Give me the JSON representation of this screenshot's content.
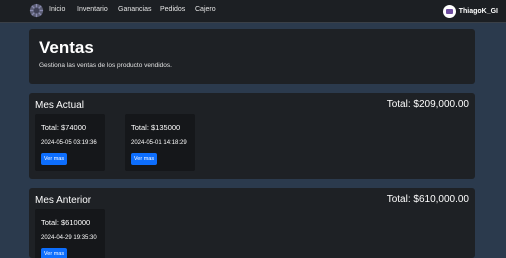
{
  "nav": {
    "items": [
      "Inicio",
      "Inventario",
      "Ganancias",
      "Pedidos",
      "Cajero"
    ],
    "username": "ThiagoK_GI"
  },
  "header": {
    "title": "Ventas",
    "subtitle": "Gestiona las ventas de los producto vendidos."
  },
  "sections": [
    {
      "title": "Mes Actual",
      "total": "Total: $209,000.00",
      "cards": [
        {
          "total": "Total: $74000",
          "date": "2024-05-05 03:19:36",
          "button": "Ver mas"
        },
        {
          "total": "Total: $135000",
          "date": "2024-05-01 14:18:29",
          "button": "Ver mas"
        }
      ]
    },
    {
      "title": "Mes Anterior",
      "total": "Total: $610,000.00",
      "cards": [
        {
          "total": "Total: $610000",
          "date": "2024-04-29 19:35:30",
          "button": "Ver mas"
        }
      ]
    }
  ],
  "colors": {
    "page_bg": "#2b3a4d",
    "navbar_bg": "#1c1f23",
    "card_bg": "#1e2125",
    "inner_card_bg": "#15171a",
    "button": "#0d6efd",
    "avatar_accent": "#6e4da0"
  },
  "icons": {
    "logo": "gear-logo-icon",
    "avatar": "user-avatar-icon"
  }
}
